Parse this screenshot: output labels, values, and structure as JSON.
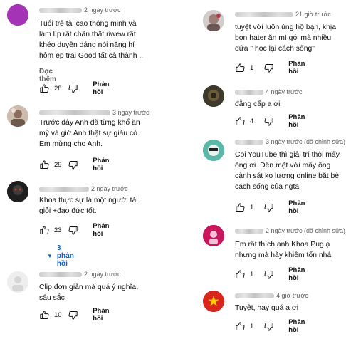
{
  "colors": {
    "link": "#065fd4",
    "muted": "#606060",
    "text": "#0f0f0f"
  },
  "left": [
    {
      "meta": "2 ngày trước",
      "lines": [
        "Tuổi trẻ tài cao thông minh và",
        "làm líp rất chân thật riwew rất",
        "khéo duyên dáng nói năng hí",
        "hỏm ep trai Good tất cả thành .."
      ],
      "read_more": "Đọc thêm",
      "likes": "28",
      "reply_label": "Phản hồi"
    },
    {
      "meta": "3 ngày trước",
      "lines": [
        "Trước đây Anh đã từng khổ ăn",
        "mỳ và giờ Anh thật sự giàu có.",
        "Em mừng cho Anh."
      ],
      "likes": "29",
      "reply_label": "Phản hồi"
    },
    {
      "meta": "2 ngày trước",
      "lines": [
        "Khoa thực sự là một người tài",
        "giỏi +đạo đức tốt."
      ],
      "likes": "23",
      "reply_label": "Phản hồi",
      "replies_label": "3 phản hồi"
    },
    {
      "meta": "2 ngày trước",
      "lines": [
        "Clip đơn giản mà quá ý nghĩa,",
        "sâu sắc"
      ],
      "likes": "10",
      "reply_label": "Phản hồi"
    }
  ],
  "right": [
    {
      "meta": "21 giờ trước",
      "lines": [
        "tuyệt vời luôn ủng hộ bạn, khịa",
        "bọn hater ăn mì gói mà nhiều",
        "đứa \" học lại cách sống\""
      ],
      "likes": "1",
      "reply_label": "Phản hồi"
    },
    {
      "meta": "4 ngày trước",
      "lines": [
        "đẳng cấp a ơi"
      ],
      "likes": "4",
      "reply_label": "Phản hồi"
    },
    {
      "meta": "3 ngày trước (đã chỉnh sửa)",
      "lines": [
        "Coi YouTube thì giải trí thôi mấy",
        "ông ơi. Đến mệt với mấy ông",
        "cảnh sát ko lương online bắt bẻ",
        "cách sống của ngta"
      ],
      "likes": "1",
      "reply_label": "Phản hồi"
    },
    {
      "meta": "2 ngày trước (đã chỉnh sửa)",
      "lines": [
        "Em rất thích anh Khoa Pug ạ",
        "nhưng mà hãy khiêm tốn nhá"
      ],
      "likes": "1",
      "reply_label": "Phản hồi"
    },
    {
      "meta": "4 giờ trước",
      "lines": [
        "Tuyệt, hay quá a ơi"
      ],
      "likes": "1",
      "reply_label": "Phản hồi"
    }
  ]
}
